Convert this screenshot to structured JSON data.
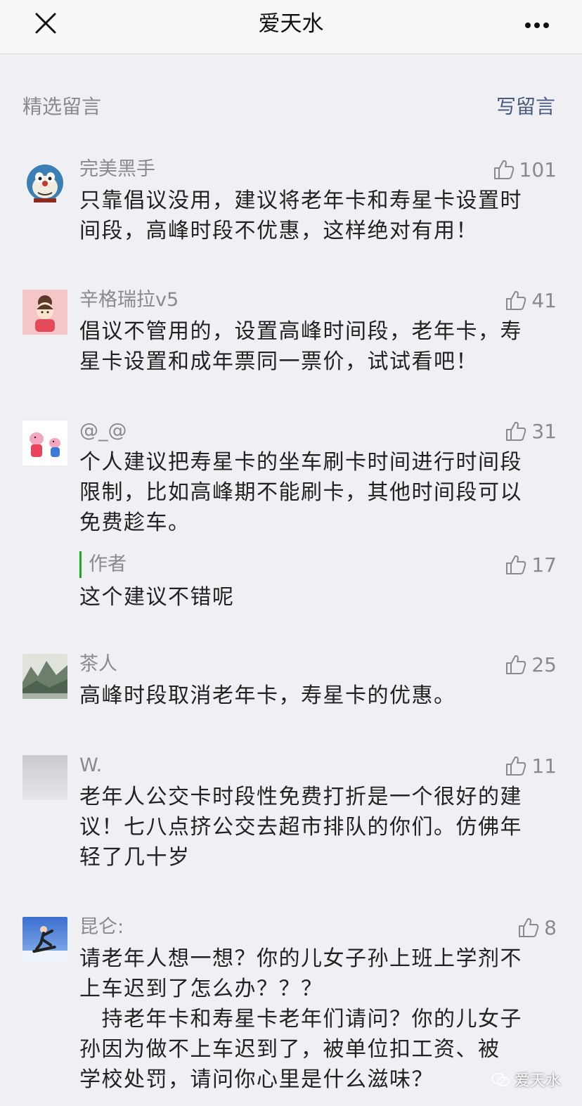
{
  "header": {
    "title": "爱天水"
  },
  "section": {
    "label": "精选留言",
    "write": "写留言"
  },
  "comments": [
    {
      "name": "完美黑手",
      "likes": "101",
      "text": "只靠倡议没用，建议将老年卡和寿星卡设置时\n间段，高峰时段不优惠，这样绝对有用！"
    },
    {
      "name": "辛格瑞拉v5",
      "likes": "41",
      "text": "倡议不管用的，设置高峰时间段，老年卡，寿\n星卡设置和成年票同一票价，试试看吧！"
    },
    {
      "name": "@_@",
      "likes": "31",
      "text": "个人建议把寿星卡的坐车刷卡时间进行时间段\n限制，比如高峰期不能刷卡，其他时间段可以\n免费趁车。",
      "reply": {
        "name": "作者",
        "likes": "17",
        "text": "这个建议不错呢"
      }
    },
    {
      "name": "茶人",
      "likes": "25",
      "text": "高峰时段取消老年卡，寿星卡的优惠。"
    },
    {
      "name": "W.",
      "likes": "11",
      "text": "老年人公交卡时段性免费打折是一个很好的建\n议！七八点挤公交去超市排队的你们。仿佛年\n轻了几十岁"
    },
    {
      "name": "昆仑:",
      "likes": "8",
      "text": "请老年人想一想？你的儿女子孙上班上学剂不\n上车迟到了怎么办？？？\n　持老年卡和寿星卡老年们请问？你的儿女子\n孙因为做不上车迟到了，被单位扣工资、被\n学校处罚，请问你心里是什么滋味？"
    }
  ],
  "watermark": {
    "text": "爱天水"
  }
}
